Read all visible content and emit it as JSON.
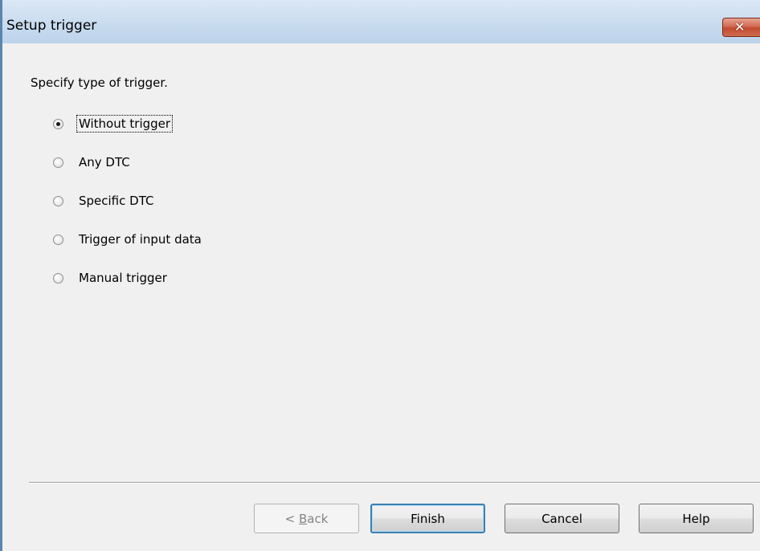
{
  "window": {
    "title": "Setup trigger",
    "close_glyph": "✕",
    "close_icon": "close-icon"
  },
  "dialog": {
    "instruction": "Specify type of trigger.",
    "options": [
      {
        "label": "Without trigger",
        "selected": true,
        "focused": true
      },
      {
        "label": "Any DTC",
        "selected": false,
        "focused": false
      },
      {
        "label": "Specific DTC",
        "selected": false,
        "focused": false
      },
      {
        "label": "Trigger of input data",
        "selected": false,
        "focused": false
      },
      {
        "label": "Manual trigger",
        "selected": false,
        "focused": false
      }
    ]
  },
  "buttons": {
    "back_prefix": "< ",
    "back_mnemonic": "B",
    "back_rest": "ack",
    "back_enabled": false,
    "finish": "Finish",
    "cancel": "Cancel",
    "help": "Help"
  }
}
